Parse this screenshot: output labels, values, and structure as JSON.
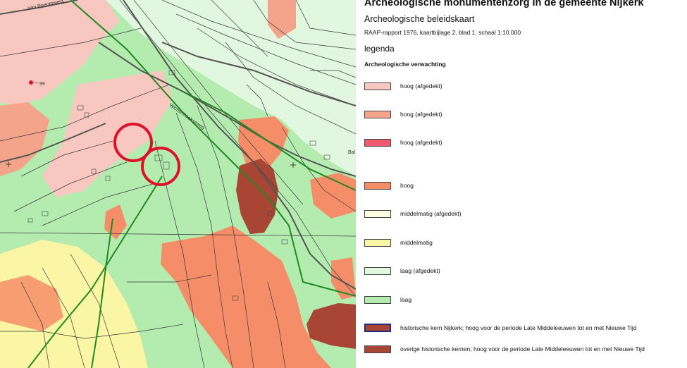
{
  "header": {
    "title": "Archeologische monumentenzorg in de gemeente Nijkerk",
    "subtitle": "Archeologische beleidskaart",
    "report": "RAAP-rapport 1976, kaartbijlage 2, blad 1, schaal 1:10.000"
  },
  "legend": {
    "heading": "legenda",
    "category": "Archeologische verwachting",
    "items": [
      {
        "label": "hoog (afgedekt)",
        "color": "#f8c7c0"
      },
      {
        "label": "hoog (afgedekt)",
        "color": "#f4a48a"
      },
      {
        "label": "hoog (afgedekt)",
        "color": "#f05a70"
      },
      {
        "label": "hoog",
        "color": "#f58e68"
      },
      {
        "label": "middelmatig (afgedekt)",
        "color": "#fdfde2"
      },
      {
        "label": "middelmatig",
        "color": "#fbf5a6"
      },
      {
        "label": "laag (afgedekt)",
        "color": "#e2f7e0"
      },
      {
        "label": "laag",
        "color": "#b4ecb0"
      },
      {
        "label": "historische kern Nijkerk; hoog voor de periode Late Middeleeuwen tot en met Nieuwe Tijd",
        "color": "#a84535",
        "border": "#1f2a7a"
      },
      {
        "label": "overige historische kernen; hoog voor de periode Late Middeleeuwen tot en met Nieuwe Tijd",
        "color": "#a84535"
      }
    ]
  },
  "map": {
    "street_labels": [
      "Van Reenenweg",
      "Wichterhoekseweg",
      "Bal"
    ],
    "findspot_number": "99"
  }
}
